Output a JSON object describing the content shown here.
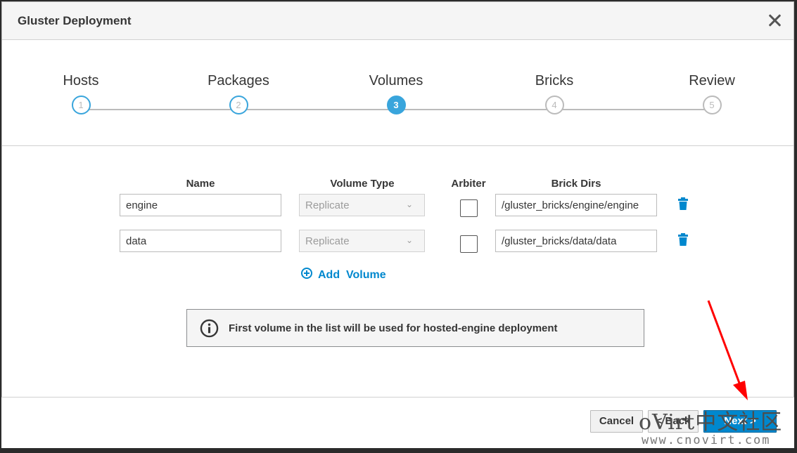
{
  "dialog": {
    "title": "Gluster Deployment"
  },
  "wizard": {
    "steps": [
      {
        "label": "Hosts",
        "number": "1",
        "state": "completed"
      },
      {
        "label": "Packages",
        "number": "2",
        "state": "completed"
      },
      {
        "label": "Volumes",
        "number": "3",
        "state": "active"
      },
      {
        "label": "Bricks",
        "number": "4",
        "state": "future"
      },
      {
        "label": "Review",
        "number": "5",
        "state": "future"
      }
    ]
  },
  "volumes": {
    "headers": {
      "name": "Name",
      "type": "Volume Type",
      "arbiter": "Arbiter",
      "brick_dirs": "Brick Dirs"
    },
    "rows": [
      {
        "name": "engine",
        "type": "Replicate",
        "arbiter": false,
        "brick_dir": "/gluster_bricks/engine/engine"
      },
      {
        "name": "data",
        "type": "Replicate",
        "arbiter": false,
        "brick_dir": "/gluster_bricks/data/data"
      }
    ],
    "add_label": "Add  Volume"
  },
  "info": {
    "text": "First volume in the list will be used for hosted-engine deployment"
  },
  "footer": {
    "cancel": "Cancel",
    "back": "< Back",
    "next": "Next >"
  },
  "watermark": {
    "brand": "oVirt中文社区",
    "url": "www.cnovirt.com"
  },
  "colors": {
    "accent": "#39a5dc",
    "link": "#0088ce",
    "annotation": "#ff0000"
  }
}
